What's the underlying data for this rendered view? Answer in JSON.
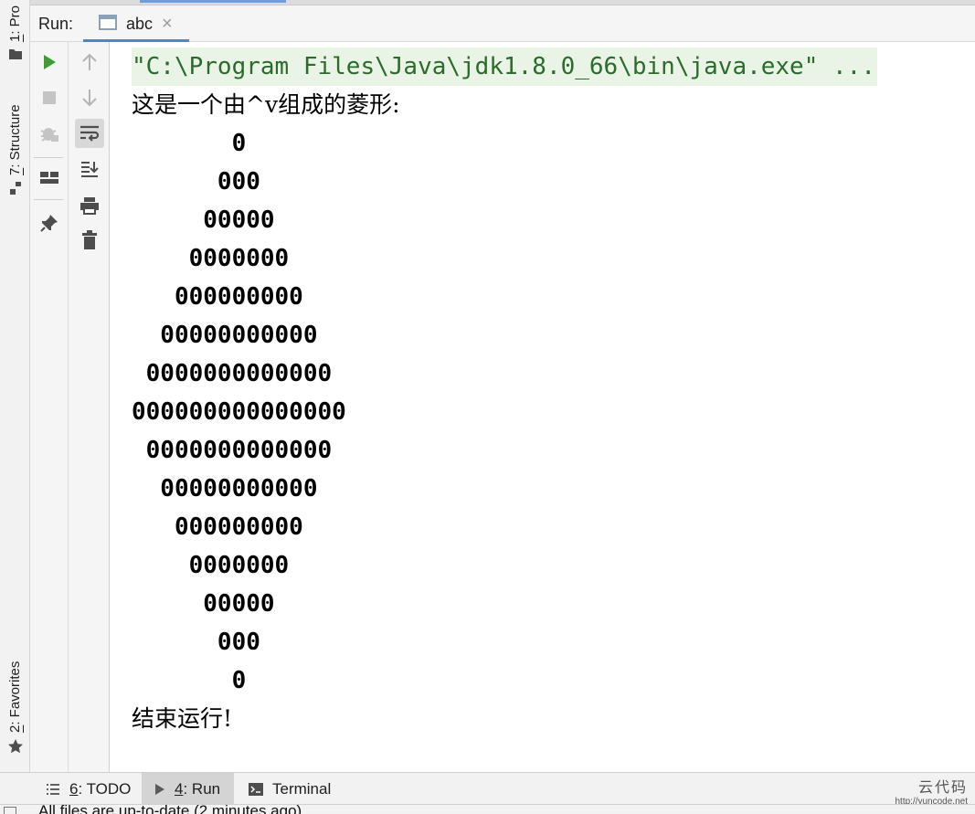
{
  "left_strip": {
    "project_tab": {
      "number": "1",
      "label": ": Pro"
    },
    "structure_tab": {
      "number": "7",
      "label": ": Structure"
    },
    "favorites_tab": {
      "number": "2",
      "label": ": Favorites"
    }
  },
  "run_panel": {
    "title": "Run:",
    "tab_name": "abc",
    "tab_close": "×"
  },
  "console": {
    "command": "\"C:\\Program Files\\Java\\jdk1.8.0_66\\bin\\java.exe\" ...",
    "intro": "这是一个由^v组成的菱形:",
    "diamond_rows": [
      "       0",
      "      000",
      "     00000",
      "    0000000",
      "   000000000",
      "  00000000000",
      " 0000000000000",
      "000000000000000",
      " 0000000000000",
      "  00000000000",
      "   000000000",
      "    0000000",
      "     00000",
      "      000",
      "       0"
    ],
    "finish": "结束运行!"
  },
  "bottom_bar": {
    "todo": {
      "number": "6",
      "label": ": TODO"
    },
    "run": {
      "number": "4",
      "label": ": Run"
    },
    "terminal": {
      "label": "Terminal"
    }
  },
  "watermark": {
    "title": "云代码",
    "url": "http://yuncode.net"
  },
  "status": {
    "text": "All files are up-to-date (2 minutes ago)"
  },
  "colors": {
    "run_green": "#3f9c35",
    "command_text": "#2b6b2b",
    "command_bg": "#e9f4e6",
    "tab_underline": "#4a88c7"
  },
  "icons": {
    "rerun": "play-icon",
    "stop": "stop-icon",
    "debug": "bug-icon",
    "layout": "layout-icon",
    "pin": "pin-icon",
    "up": "arrow-up-icon",
    "down": "arrow-down-icon",
    "wrap": "soft-wrap-icon",
    "scroll": "scroll-to-end-icon",
    "print": "print-icon",
    "trash": "trash-icon"
  }
}
